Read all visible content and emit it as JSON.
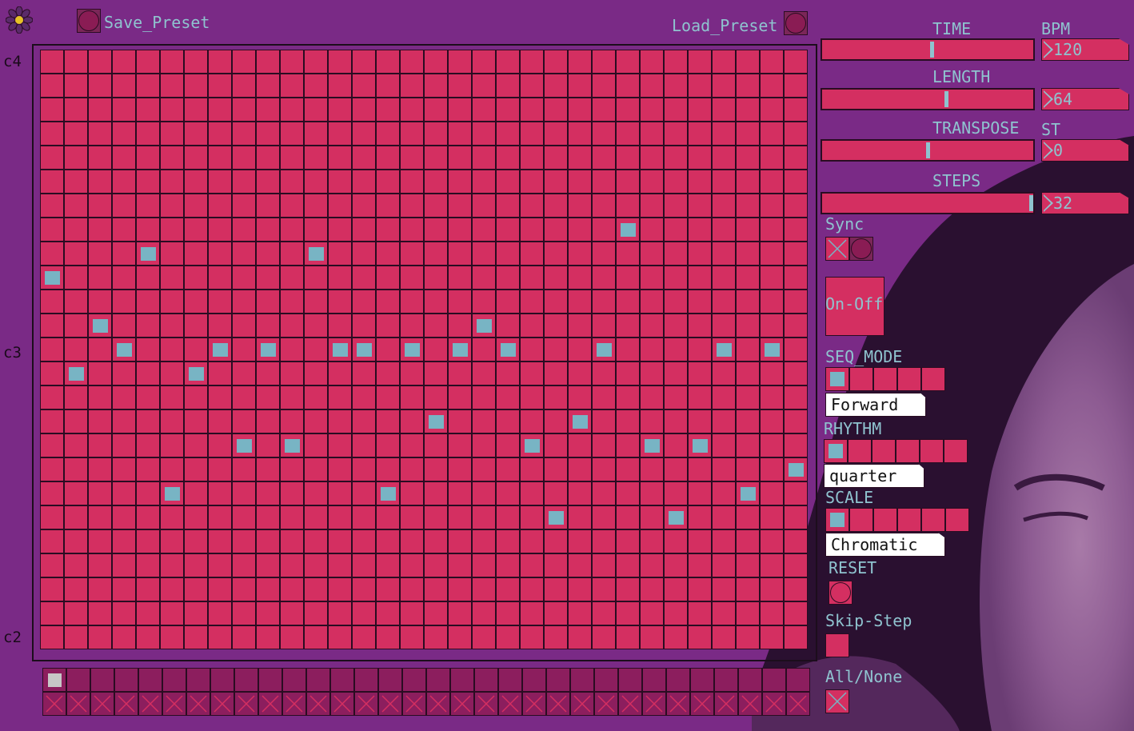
{
  "header": {
    "save_preset": "Save_Preset",
    "load_preset": "Load_Preset"
  },
  "note_labels": {
    "top": "c4",
    "middle": "c3",
    "bottom": "c2"
  },
  "grid": {
    "columns": 32,
    "rows": 25,
    "active_cells": [
      [
        24,
        7
      ],
      [
        4,
        8
      ],
      [
        11,
        8
      ],
      [
        0,
        9
      ],
      [
        2,
        11
      ],
      [
        18,
        11
      ],
      [
        3,
        12
      ],
      [
        7,
        12
      ],
      [
        9,
        12
      ],
      [
        12,
        12
      ],
      [
        13,
        12
      ],
      [
        15,
        12
      ],
      [
        17,
        12
      ],
      [
        19,
        12
      ],
      [
        23,
        12
      ],
      [
        28,
        12
      ],
      [
        30,
        12
      ],
      [
        1,
        13
      ],
      [
        6,
        13
      ],
      [
        16,
        15
      ],
      [
        22,
        15
      ],
      [
        8,
        16
      ],
      [
        10,
        16
      ],
      [
        20,
        16
      ],
      [
        25,
        16
      ],
      [
        27,
        16
      ],
      [
        31,
        17
      ],
      [
        5,
        18
      ],
      [
        14,
        18
      ],
      [
        29,
        18
      ],
      [
        21,
        19
      ],
      [
        26,
        19
      ]
    ],
    "current_step": 0
  },
  "controls": {
    "time_label": "TIME",
    "bpm_label": "BPM",
    "bpm_value": "120",
    "time_fraction": 0.52,
    "length_label": "LENGTH",
    "length_value": "64",
    "length_fraction": 0.59,
    "transpose_label": "TRANSPOSE",
    "st_label": "ST",
    "transpose_value": "0",
    "transpose_fraction": 0.5,
    "steps_label": "STEPS",
    "steps_value": "32",
    "steps_fraction": 1.0,
    "sync_label": "Sync",
    "onoff_label": "On-Off",
    "seq_mode_label": "SEQ_MODE",
    "seq_mode_value": "Forward",
    "seq_mode_selected": 0,
    "rhythm_label": "RHYTHM",
    "rhythm_value": "quarter",
    "rhythm_selected": 0,
    "scale_label": "SCALE",
    "scale_value": "Chromatic",
    "scale_selected": 0,
    "reset_label": "RESET",
    "skip_step_label": "Skip-Step",
    "all_none_label": "All/None"
  },
  "colors": {
    "background": "#7a2a86",
    "cell": "#d42f61",
    "active": "#78b4c4",
    "label": "#8fc3cf"
  }
}
